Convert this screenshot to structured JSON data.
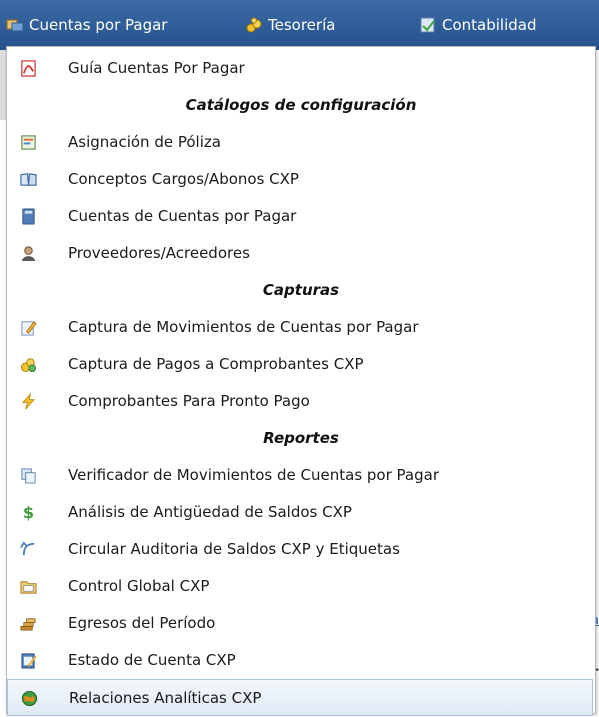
{
  "menubar": {
    "items": [
      {
        "label": "Cuentas por Pagar",
        "icon": "payables-icon"
      },
      {
        "label": "Tesorería",
        "icon": "treasury-icon"
      },
      {
        "label": "Contabilidad",
        "icon": "accounting-icon"
      }
    ]
  },
  "background": {
    "underline_fragment": "a",
    "fragment_r": "r",
    "fragment_i": "i"
  },
  "dropdown": {
    "guide": {
      "label": "Guía Cuentas Por Pagar",
      "icon": "pdf-icon"
    },
    "sections": [
      {
        "header": "Catálogos de configuración",
        "items": [
          {
            "label": "Asignación de Póliza",
            "icon": "policy-icon"
          },
          {
            "label": "Conceptos Cargos/Abonos CXP",
            "icon": "book-icon"
          },
          {
            "label": "Cuentas de Cuentas por Pagar",
            "icon": "ledger-icon"
          },
          {
            "label": "Proveedores/Acreedores",
            "icon": "user-icon"
          }
        ]
      },
      {
        "header": "Capturas",
        "items": [
          {
            "label": "Captura de Movimientos de Cuentas por Pagar",
            "icon": "edit-icon"
          },
          {
            "label": "Captura de Pagos a Comprobantes CXP",
            "icon": "coins-icon"
          },
          {
            "label": "Comprobantes Para Pronto Pago",
            "icon": "lightning-icon"
          }
        ]
      },
      {
        "header": "Reportes",
        "items": [
          {
            "label": "Verificador de Movimientos de Cuentas por Pagar",
            "icon": "copy-icon"
          },
          {
            "label": "Análisis de Antigüedad de Saldos CXP",
            "icon": "dollar-icon"
          },
          {
            "label": "Circular Auditoria de Saldos CXP y Etiquetas",
            "icon": "arrow-icon"
          },
          {
            "label": "Control Global CXP",
            "icon": "folder-icon"
          },
          {
            "label": "Egresos del Período",
            "icon": "stack-icon"
          },
          {
            "label": "Estado de Cuenta CXP",
            "icon": "notepad-icon"
          },
          {
            "label": "Relaciones Analíticas CXP",
            "icon": "globe-icon"
          }
        ]
      }
    ]
  },
  "colors": {
    "menubar": "#24528d",
    "highlight": "#f0ff00",
    "hover_border": "#a9c2e0"
  }
}
